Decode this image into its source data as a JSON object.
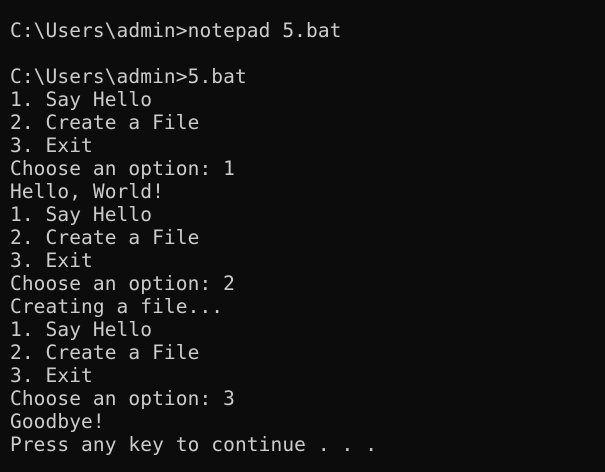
{
  "terminal": {
    "lines": [
      "C:\\Users\\admin>notepad 5.bat",
      "",
      "C:\\Users\\admin>5.bat",
      "1. Say Hello",
      "2. Create a File",
      "3. Exit",
      "Choose an option: 1",
      "Hello, World!",
      "1. Say Hello",
      "2. Create a File",
      "3. Exit",
      "Choose an option: 2",
      "Creating a file...",
      "1. Say Hello",
      "2. Create a File",
      "3. Exit",
      "Choose an option: 3",
      "Goodbye!",
      "Press any key to continue . . ."
    ],
    "colors": {
      "background": "#0c0c0c",
      "text": "#cccccc"
    }
  }
}
